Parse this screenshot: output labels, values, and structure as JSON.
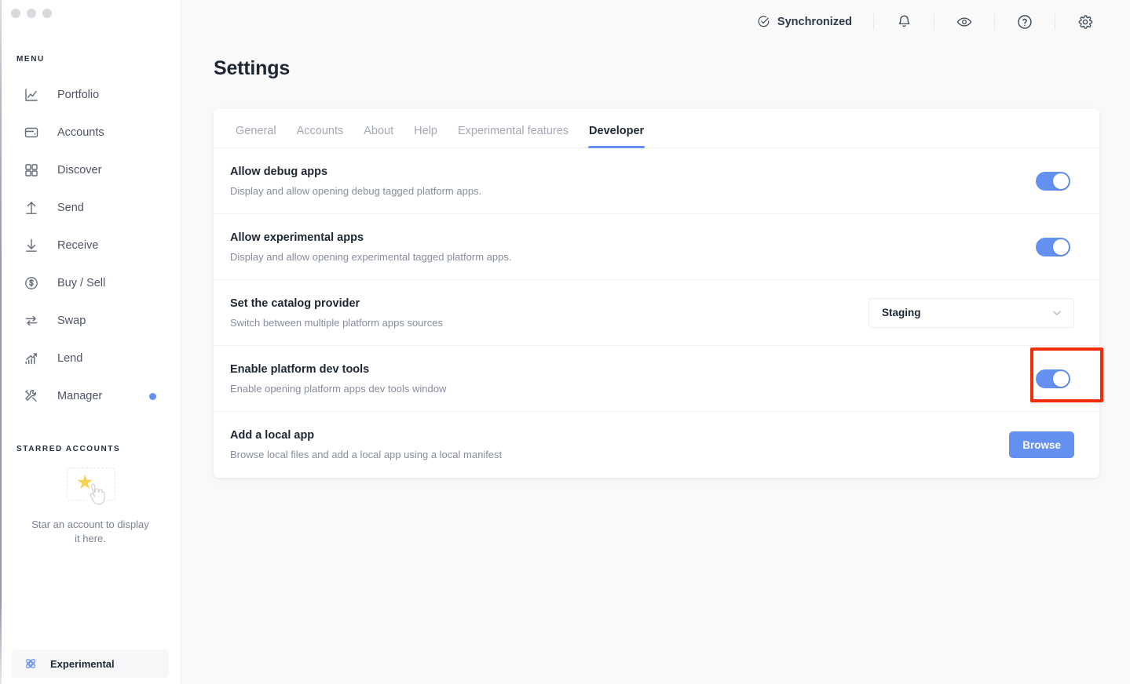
{
  "window": {
    "traffic_lights": [
      "close",
      "minimize",
      "maximize"
    ]
  },
  "sidebar": {
    "menu_label": "MENU",
    "items": [
      {
        "label": "Portfolio",
        "icon": "chart-line-icon",
        "badge": false
      },
      {
        "label": "Accounts",
        "icon": "wallet-icon",
        "badge": false
      },
      {
        "label": "Discover",
        "icon": "grid-icon",
        "badge": false
      },
      {
        "label": "Send",
        "icon": "arrow-up-icon",
        "badge": false
      },
      {
        "label": "Receive",
        "icon": "arrow-down-icon",
        "badge": false
      },
      {
        "label": "Buy / Sell",
        "icon": "dollar-circle-icon",
        "badge": false
      },
      {
        "label": "Swap",
        "icon": "swap-arrows-icon",
        "badge": false
      },
      {
        "label": "Lend",
        "icon": "bar-chart-growth-icon",
        "badge": false
      },
      {
        "label": "Manager",
        "icon": "wrench-screwdriver-icon",
        "badge": true
      }
    ],
    "starred_label": "STARRED ACCOUNTS",
    "starred_empty_text": "Star an account to display it here.",
    "starred_icon": "star-icon",
    "footer": {
      "label": "Experimental",
      "icon": "atom-icon"
    }
  },
  "topbar": {
    "sync_label": "Synchronized",
    "sync_icon": "check-circle-icon",
    "icons": [
      {
        "name": "bell-icon"
      },
      {
        "name": "eye-icon"
      },
      {
        "name": "question-circle-icon"
      },
      {
        "name": "gear-icon"
      }
    ]
  },
  "page": {
    "title": "Settings"
  },
  "tabs": [
    {
      "label": "General",
      "active": false
    },
    {
      "label": "Accounts",
      "active": false
    },
    {
      "label": "About",
      "active": false
    },
    {
      "label": "Help",
      "active": false
    },
    {
      "label": "Experimental features",
      "active": false
    },
    {
      "label": "Developer",
      "active": true
    }
  ],
  "settings_rows": [
    {
      "title": "Allow debug apps",
      "description": "Display and allow opening debug tagged platform apps.",
      "control": "toggle",
      "value": "on"
    },
    {
      "title": "Allow experimental apps",
      "description": "Display and allow opening experimental tagged platform apps.",
      "control": "toggle",
      "value": "on"
    },
    {
      "title": "Set the catalog provider",
      "description": "Switch between multiple platform apps sources",
      "control": "select",
      "value": "Staging"
    },
    {
      "title": "Enable platform dev tools",
      "description": "Enable opening platform apps dev tools window",
      "control": "toggle",
      "value": "on",
      "highlighted": true
    },
    {
      "title": "Add a local app",
      "description": "Browse local files and add a local app using a local manifest",
      "control": "button",
      "value": "Browse"
    }
  ],
  "colors": {
    "accent": "#6490f1",
    "highlight": "#f42c05",
    "star": "#f7d154",
    "text_primary": "#1d2733",
    "text_muted": "#868d9b"
  }
}
